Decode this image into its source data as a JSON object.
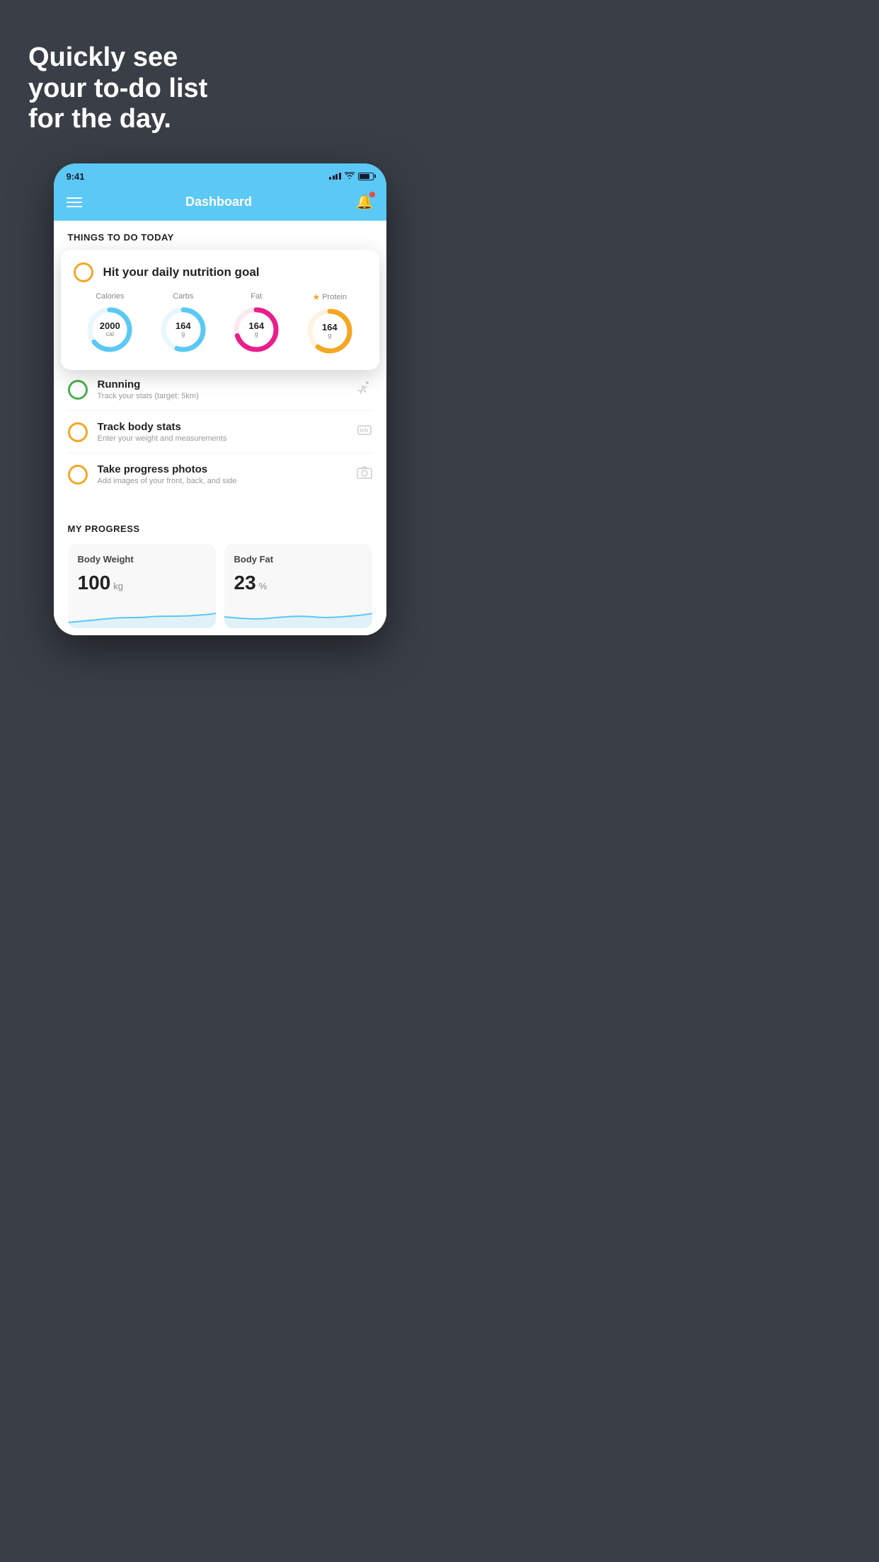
{
  "hero": {
    "title": "Quickly see\nyour to-do list\nfor the day."
  },
  "statusBar": {
    "time": "9:41"
  },
  "appHeader": {
    "title": "Dashboard"
  },
  "todaySection": {
    "heading": "THINGS TO DO TODAY"
  },
  "floatingCard": {
    "circleColor": "yellow",
    "title": "Hit your daily nutrition goal",
    "nutrition": [
      {
        "label": "Calories",
        "value": "2000",
        "unit": "cal",
        "color": "#5bc8f5",
        "percent": 65,
        "starred": false
      },
      {
        "label": "Carbs",
        "value": "164",
        "unit": "g",
        "color": "#5bc8f5",
        "percent": 55,
        "starred": false
      },
      {
        "label": "Fat",
        "value": "164",
        "unit": "g",
        "color": "#e91e8c",
        "percent": 70,
        "starred": false
      },
      {
        "label": "Protein",
        "value": "164",
        "unit": "g",
        "color": "#f5a623",
        "percent": 60,
        "starred": true
      }
    ]
  },
  "todoItems": [
    {
      "checkColor": "green",
      "title": "Running",
      "subtitle": "Track your stats (target: 5km)",
      "icon": "shoe"
    },
    {
      "checkColor": "yellow",
      "title": "Track body stats",
      "subtitle": "Enter your weight and measurements",
      "icon": "scale"
    },
    {
      "checkColor": "yellow",
      "title": "Take progress photos",
      "subtitle": "Add images of your front, back, and side",
      "icon": "person"
    }
  ],
  "progressSection": {
    "heading": "MY PROGRESS",
    "cards": [
      {
        "title": "Body Weight",
        "value": "100",
        "unit": "kg"
      },
      {
        "title": "Body Fat",
        "value": "23",
        "unit": "%"
      }
    ]
  }
}
